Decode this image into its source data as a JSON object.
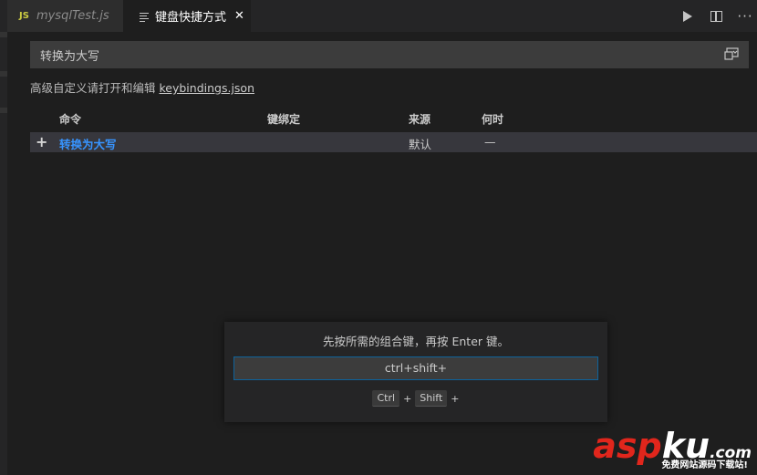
{
  "tabs": [
    {
      "label": "mysqlTest.js",
      "badge": "JS"
    },
    {
      "label": "键盘快捷方式",
      "close": "✕"
    }
  ],
  "search": {
    "value": "转换为大写"
  },
  "hint": {
    "text": "高级自定义请打开和编辑 ",
    "link": "keybindings.json"
  },
  "table": {
    "headers": [
      "命令",
      "键绑定",
      "来源",
      "何时"
    ],
    "rows": [
      {
        "plus": "+",
        "command": "转换为大写",
        "keybinding": "",
        "source": "默认",
        "when": "—"
      }
    ]
  },
  "dialog": {
    "message": "先按所需的组合键，再按 Enter 键。",
    "input_value": "ctrl+shift+",
    "keys": [
      "Ctrl",
      "+",
      "Shift",
      "+"
    ]
  },
  "watermark": {
    "main_asp": "asp",
    "main_ku": "ku",
    "main_com": ".com",
    "sub": "免费网站源码下载站!"
  },
  "colors": {
    "accent_link": "#3794ff",
    "focus_border": "#0e639c",
    "watermark_red": "#e1261c"
  }
}
